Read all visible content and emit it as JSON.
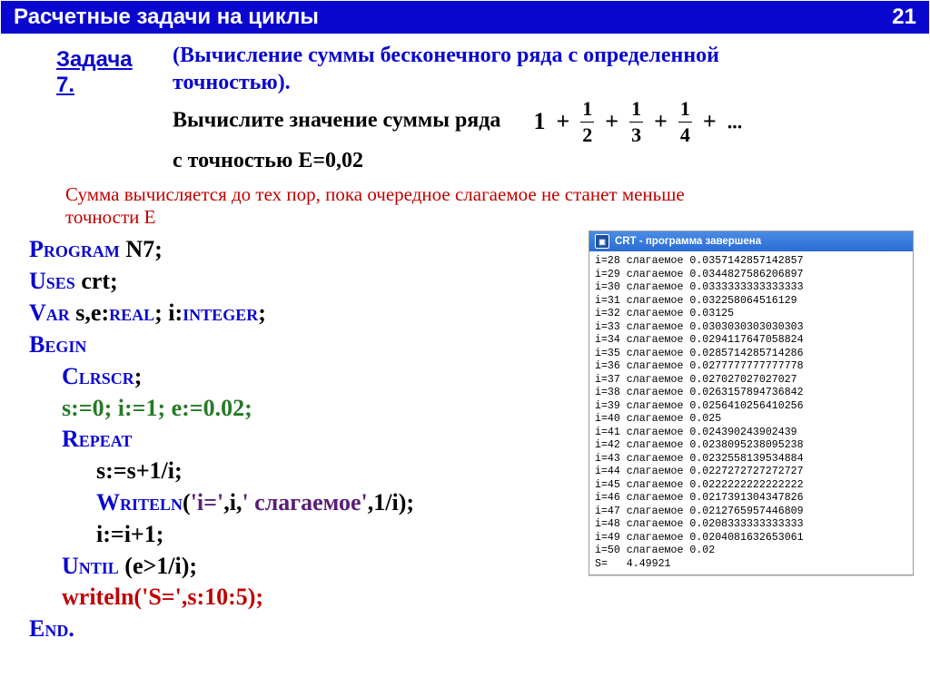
{
  "header": {
    "title": "Расчетные задачи на циклы",
    "page": "21"
  },
  "task": {
    "label": "Задача 7."
  },
  "desc": {
    "line1a": "(Вычисление суммы бесконечного ряда с определенной",
    "line1b": "точностью).",
    "line2": "Вычислите значение суммы ряда",
    "line3": "с точностью E=0,02"
  },
  "formula": {
    "one": "1",
    "plus": "+",
    "n1": "1",
    "d1": "2",
    "n2": "1",
    "d2": "3",
    "n3": "1",
    "d3": "4",
    "dots": "..."
  },
  "hint": {
    "l1": "Сумма вычисляется до тех пор, пока очередное слагаемое не станет меньше",
    "l2": "точности E"
  },
  "code": {
    "l1_k": "Program",
    "l1_n": " N7;",
    "l2_k": "Uses",
    "l2_n": " crt;",
    "l3_k": "Var",
    "l3_n": "  s,e:",
    "l3_k2": "real",
    "l3_n2": ";   i:",
    "l3_k3": "integer",
    "l3_n3": ";",
    "l4": "Begin",
    "l5_k": "Clrscr",
    "l5_n": ";",
    "l6": "s:=0;  i:=1;  e:=0.02;",
    "l7": "Repeat",
    "l8": "s:=s+1/i;",
    "l9_k": "Writeln",
    "l9_a": "(",
    "l9_s1": "'i='",
    "l9_c": ",",
    "l9_v": "i",
    "l9_c2": ",",
    "l9_s2": "' слагаемое'",
    "l9_c3": ",",
    "l9_v2": "1/i",
    "l9_b": ");",
    "l10": "i:=i+1;",
    "l11_k": "Until",
    "l11_n": " (e>1/i);",
    "l12_k": "writeln",
    "l12_a": "(",
    "l12_s": "'S='",
    "l12_c": ",",
    "l12_v": "s:10:5",
    "l12_b": ");",
    "l13": "End."
  },
  "crt": {
    "title": "CRT - программа завершена",
    "rows": [
      {
        "i": 28,
        "v": "0.0357142857142857"
      },
      {
        "i": 29,
        "v": "0.0344827586206897"
      },
      {
        "i": 30,
        "v": "0.0333333333333333"
      },
      {
        "i": 31,
        "v": "0.032258064516129"
      },
      {
        "i": 32,
        "v": "0.03125"
      },
      {
        "i": 33,
        "v": "0.0303030303030303"
      },
      {
        "i": 34,
        "v": "0.0294117647058824"
      },
      {
        "i": 35,
        "v": "0.0285714285714286"
      },
      {
        "i": 36,
        "v": "0.0277777777777778"
      },
      {
        "i": 37,
        "v": "0.027027027027027"
      },
      {
        "i": 38,
        "v": "0.0263157894736842"
      },
      {
        "i": 39,
        "v": "0.0256410256410256"
      },
      {
        "i": 40,
        "v": "0.025"
      },
      {
        "i": 41,
        "v": "0.024390243902439"
      },
      {
        "i": 42,
        "v": "0.0238095238095238"
      },
      {
        "i": 43,
        "v": "0.0232558139534884"
      },
      {
        "i": 44,
        "v": "0.0227272727272727"
      },
      {
        "i": 45,
        "v": "0.0222222222222222"
      },
      {
        "i": 46,
        "v": "0.0217391304347826"
      },
      {
        "i": 47,
        "v": "0.0212765957446809"
      },
      {
        "i": 48,
        "v": "0.0208333333333333"
      },
      {
        "i": 49,
        "v": "0.0204081632653061"
      },
      {
        "i": 50,
        "v": "0.02"
      }
    ],
    "sum_label": "S=",
    "sum_value": "   4.49921"
  }
}
